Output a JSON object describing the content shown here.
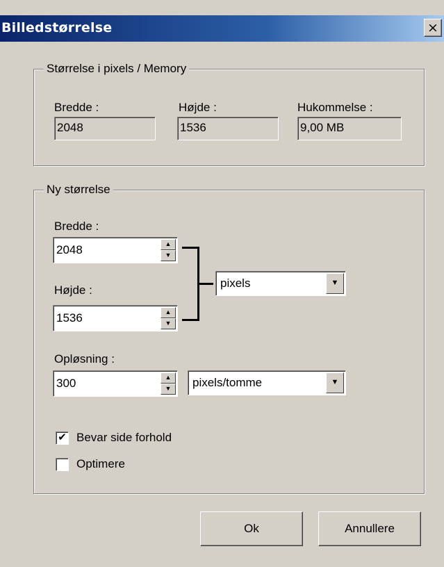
{
  "window": {
    "title": "Billedstørrelse",
    "close_glyph": "×"
  },
  "size_group": {
    "legend": "Størrelse i pixels / Memory",
    "width_label": "Bredde :",
    "height_label": "Højde :",
    "memory_label": "Hukommelse :",
    "width_value": "2048",
    "height_value": "1536",
    "memory_value": "9,00 MB"
  },
  "new_size_group": {
    "legend": "Ny størrelse",
    "width_label": "Bredde :",
    "width_value": "2048",
    "height_label": "Højde :",
    "height_value": "1536",
    "unit_value": "pixels",
    "resolution_label": "Opløsning :",
    "resolution_value": "300",
    "resolution_unit_value": "pixels/tomme",
    "keep_ratio_label": "Bevar side forhold",
    "keep_ratio_checked": true,
    "optimize_label": "Optimere",
    "optimize_checked": false
  },
  "buttons": {
    "ok": "Ok",
    "cancel": "Annullere"
  },
  "icons": {
    "spin_up": "▲",
    "spin_down": "▼",
    "dropdown": "▼",
    "checkmark": "✔"
  }
}
